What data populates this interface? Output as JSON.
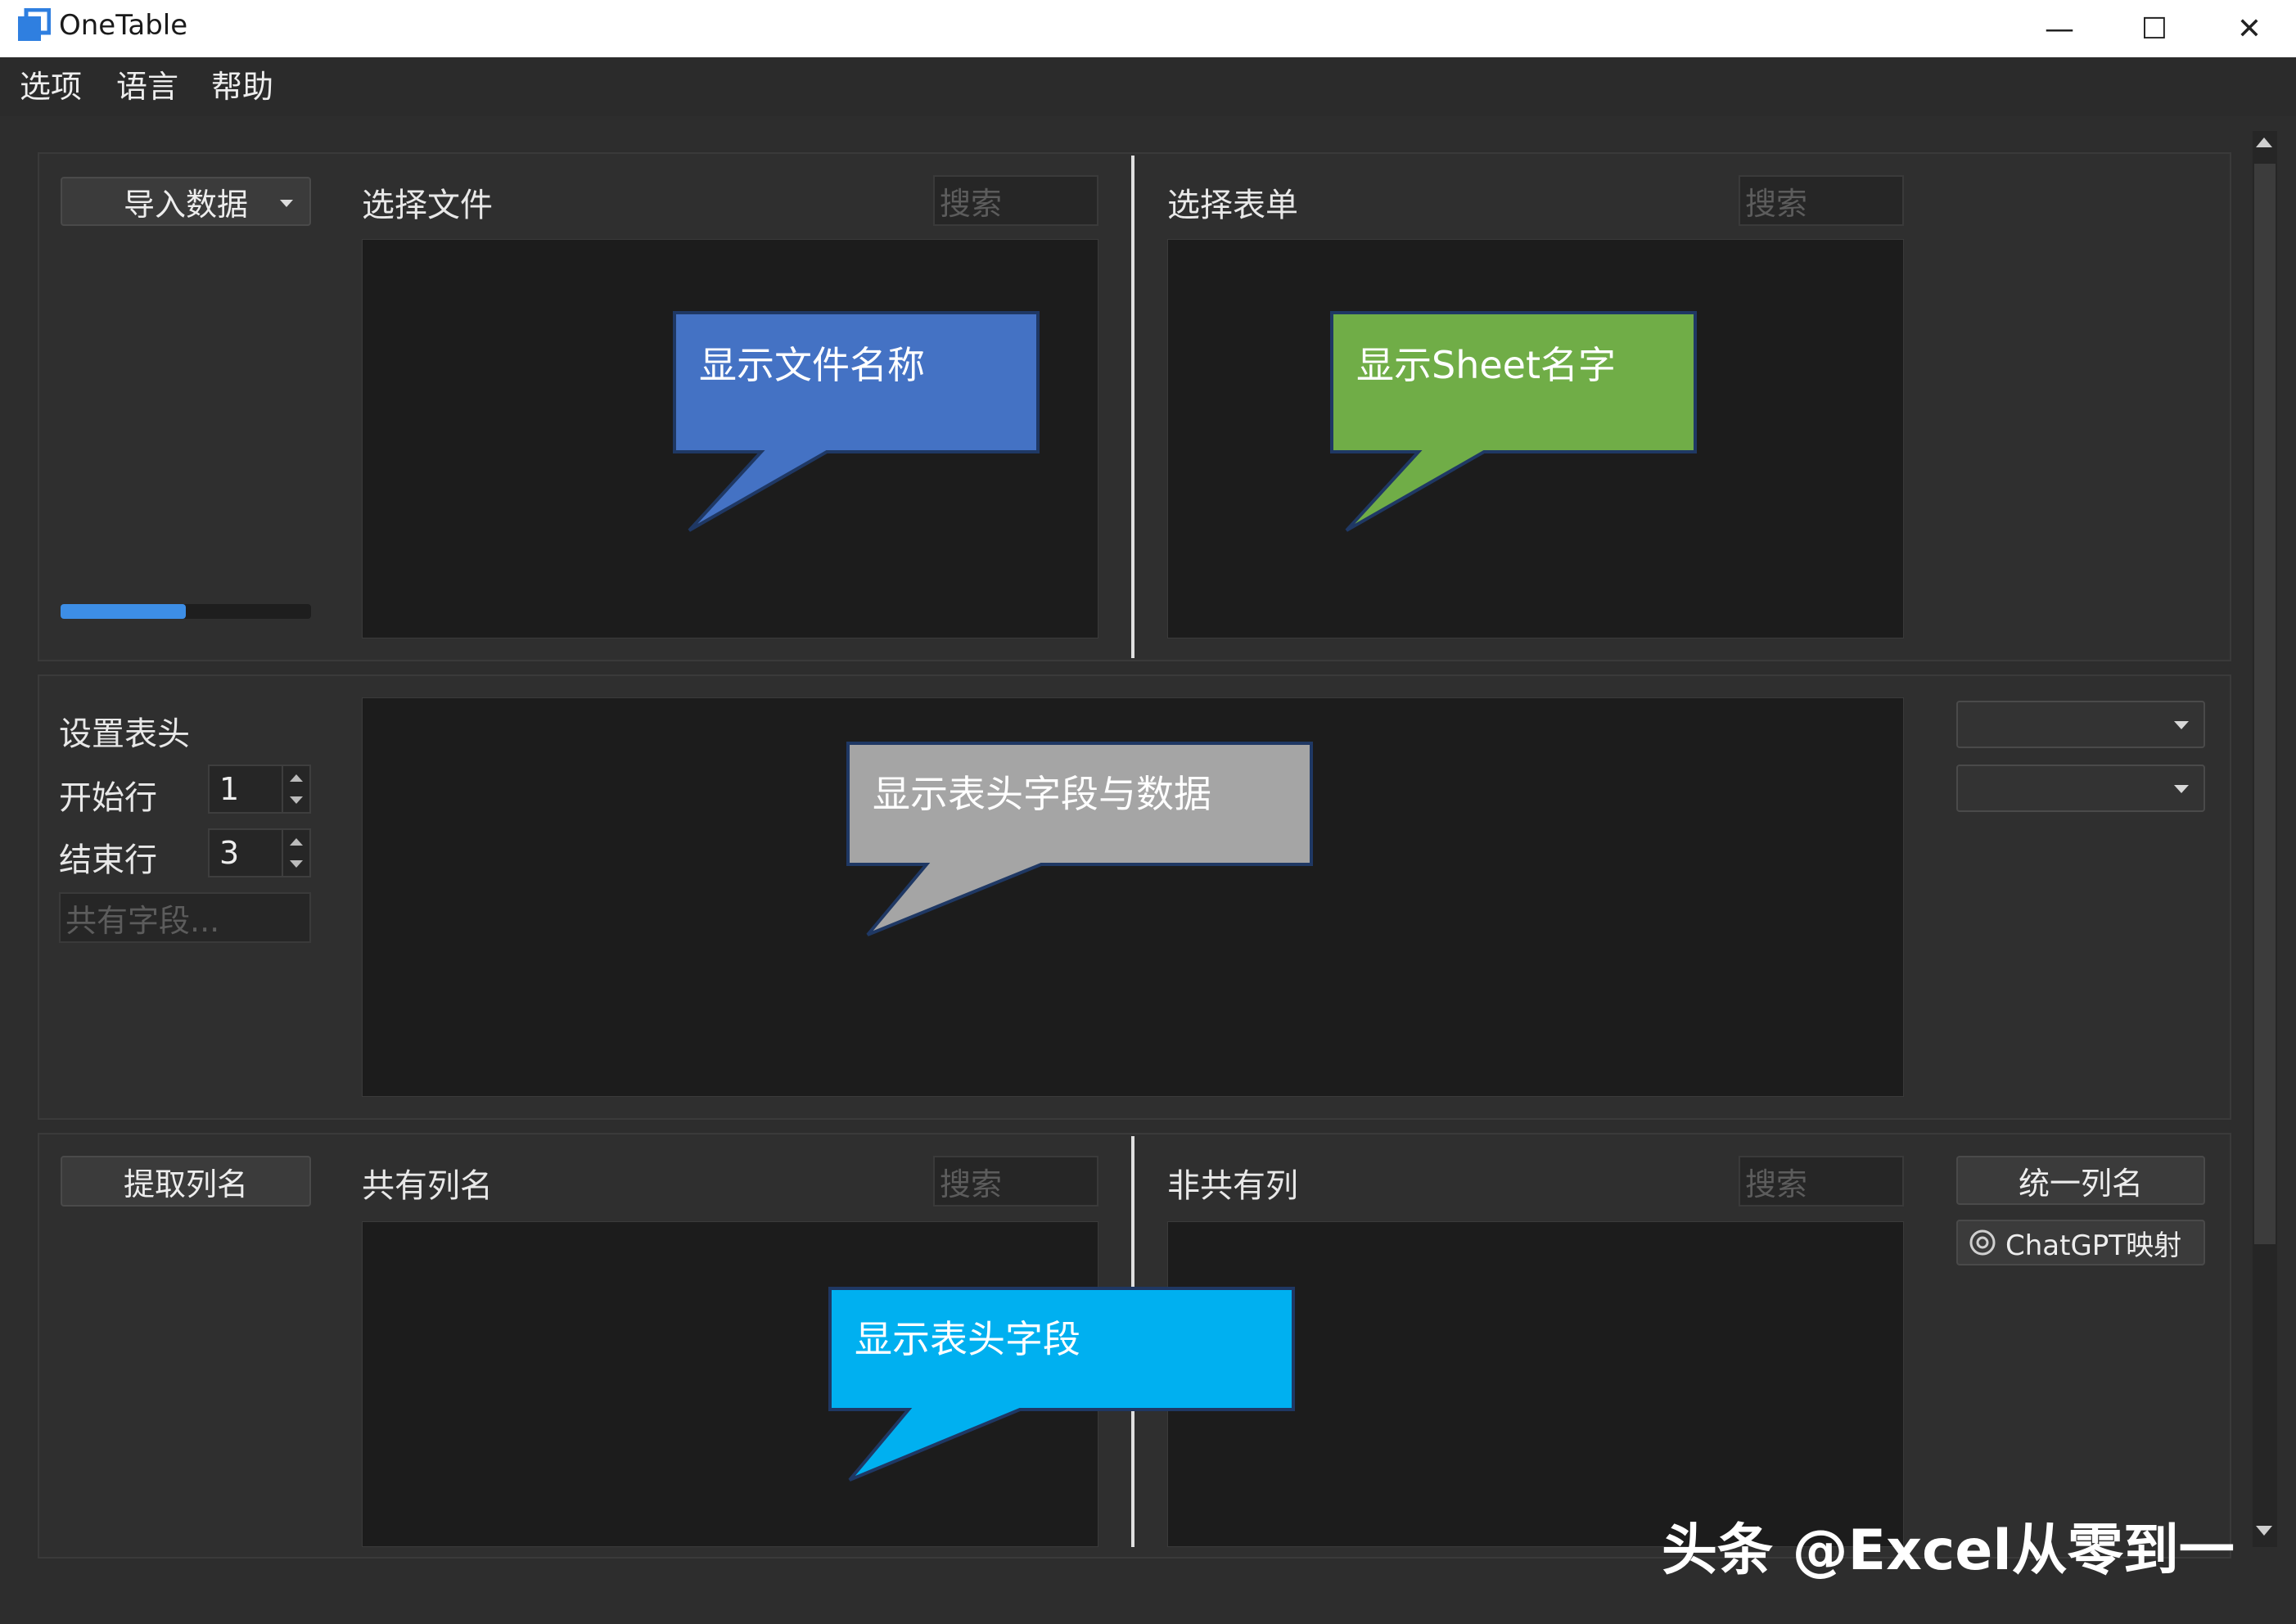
{
  "window": {
    "title": "OneTable",
    "minimize_glyph": "—",
    "maximize_glyph": "☐",
    "close_glyph": "✕"
  },
  "menu": [
    "选项",
    "语言",
    "帮助"
  ],
  "files_panel": {
    "import_button": "导入数据",
    "progress": 0.5,
    "file_title": "选择文件",
    "file_search_placeholder": "搜索",
    "sheet_title": "选择表单",
    "sheet_search_placeholder": "搜索"
  },
  "header_panel": {
    "title": "设置表头",
    "start_row_label": "开始行",
    "start_row_value": "1",
    "end_row_label": "结束行",
    "end_row_value": "3",
    "common_field_placeholder": "共有字段..."
  },
  "columns_panel": {
    "extract_button": "提取列名",
    "common_title": "共有列名",
    "common_search_placeholder": "搜索",
    "noncommon_title": "非共有列",
    "noncommon_search_placeholder": "搜索",
    "unify_button": "统一列名",
    "chatgpt_button": "ChatGPT映射"
  },
  "callouts": {
    "file_names": {
      "text": "显示文件名称",
      "color": "#4472c4"
    },
    "sheet_names": {
      "text": "显示Sheet名字",
      "color": "#70ad47"
    },
    "header_data": {
      "text": "显示表头字段与数据",
      "color": "#a5a5a5"
    },
    "header_fields": {
      "text": "显示表头字段",
      "color": "#00b0f0"
    }
  },
  "watermark": "头条 @Excel从零到一"
}
